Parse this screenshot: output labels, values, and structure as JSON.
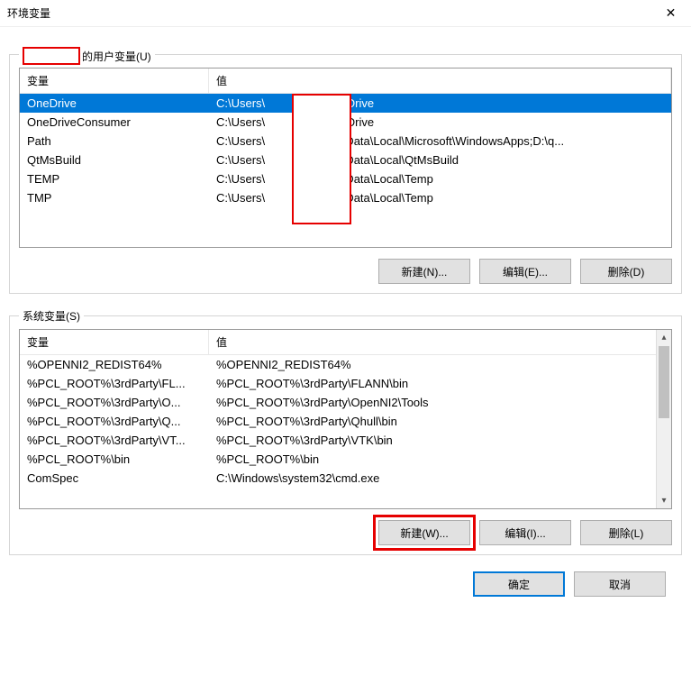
{
  "window": {
    "title": "环境变量",
    "close_glyph": "✕"
  },
  "user_section": {
    "label_suffix": "的用户变量(U)",
    "columns": {
      "var": "变量",
      "val": "值"
    },
    "rows": [
      {
        "var": "OneDrive",
        "val_prefix": "C:\\Users\\",
        "val_suffix": "OneDrive",
        "selected": true
      },
      {
        "var": "OneDriveConsumer",
        "val_prefix": "C:\\Users\\",
        "val_suffix": "OneDrive"
      },
      {
        "var": "Path",
        "val_prefix": "C:\\Users\\",
        "val_suffix": "AppData\\Local\\Microsoft\\WindowsApps;D:\\q..."
      },
      {
        "var": "QtMsBuild",
        "val_prefix": "C:\\Users\\",
        "val_suffix": "AppData\\Local\\QtMsBuild"
      },
      {
        "var": "TEMP",
        "val_prefix": "C:\\Users\\",
        "val_suffix": "AppData\\Local\\Temp"
      },
      {
        "var": "TMP",
        "val_prefix": "C:\\Users\\",
        "val_suffix": "AppData\\Local\\Temp"
      }
    ],
    "buttons": {
      "new": "新建(N)...",
      "edit": "编辑(E)...",
      "delete": "删除(D)"
    }
  },
  "system_section": {
    "label": "系统变量(S)",
    "columns": {
      "var": "变量",
      "val": "值"
    },
    "rows": [
      {
        "var": "%OPENNI2_REDIST64%",
        "val": "%OPENNI2_REDIST64%"
      },
      {
        "var": "%PCL_ROOT%\\3rdParty\\FL...",
        "val": "%PCL_ROOT%\\3rdParty\\FLANN\\bin"
      },
      {
        "var": "%PCL_ROOT%\\3rdParty\\O...",
        "val": "%PCL_ROOT%\\3rdParty\\OpenNI2\\Tools"
      },
      {
        "var": "%PCL_ROOT%\\3rdParty\\Q...",
        "val": "%PCL_ROOT%\\3rdParty\\Qhull\\bin"
      },
      {
        "var": "%PCL_ROOT%\\3rdParty\\VT...",
        "val": "%PCL_ROOT%\\3rdParty\\VTK\\bin"
      },
      {
        "var": "%PCL_ROOT%\\bin",
        "val": "%PCL_ROOT%\\bin"
      },
      {
        "var": "ComSpec",
        "val": "C:\\Windows\\system32\\cmd.exe"
      }
    ],
    "buttons": {
      "new": "新建(W)...",
      "edit": "编辑(I)...",
      "delete": "删除(L)"
    }
  },
  "footer": {
    "ok": "确定",
    "cancel": "取消"
  }
}
